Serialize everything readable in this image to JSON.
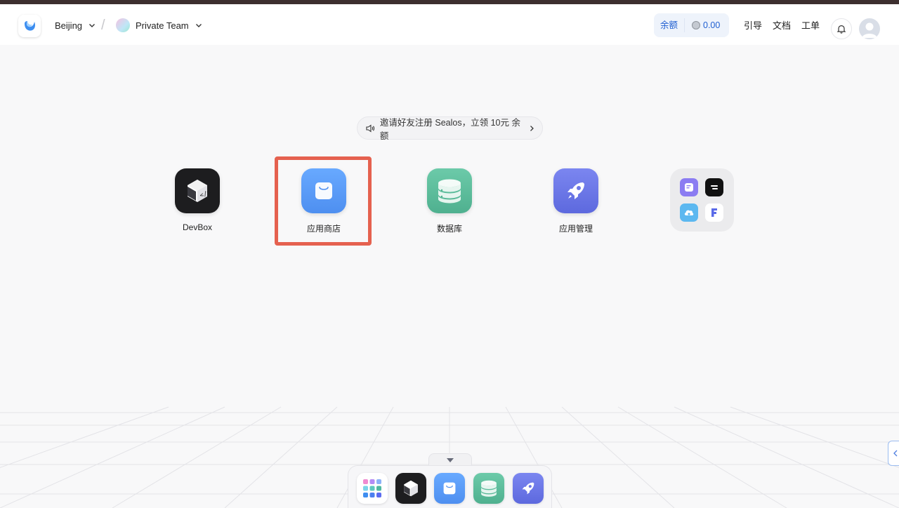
{
  "header": {
    "region": "Beijing",
    "team": "Private Team",
    "balance_label": "余额",
    "balance_value": "0.00",
    "links": [
      "引导",
      "文档",
      "工单"
    ]
  },
  "invite_banner": "邀请好友注册 Sealos，立领 10元 余额",
  "apps": [
    {
      "name": "DevBox",
      "icon": "devbox-cube-icon"
    },
    {
      "name": "应用商店",
      "icon": "shopping-bag-icon"
    },
    {
      "name": "数据库",
      "icon": "database-icon"
    },
    {
      "name": "应用管理",
      "icon": "rocket-icon"
    }
  ],
  "folder_icons": [
    "note-icon",
    "terminal-icon",
    "cloud-icon",
    "f-logo-icon"
  ],
  "dock_icons": [
    "app-grid-icon",
    "devbox-cube-icon",
    "shopping-bag-icon",
    "database-icon",
    "rocket-icon"
  ],
  "colors": {
    "accent_blue": "#1f5fd1",
    "highlight_red": "#e5614f",
    "store_blue": "#5b9cf5",
    "db_green": "#5cbfa0",
    "rocket_purple": "#6e7bea"
  }
}
